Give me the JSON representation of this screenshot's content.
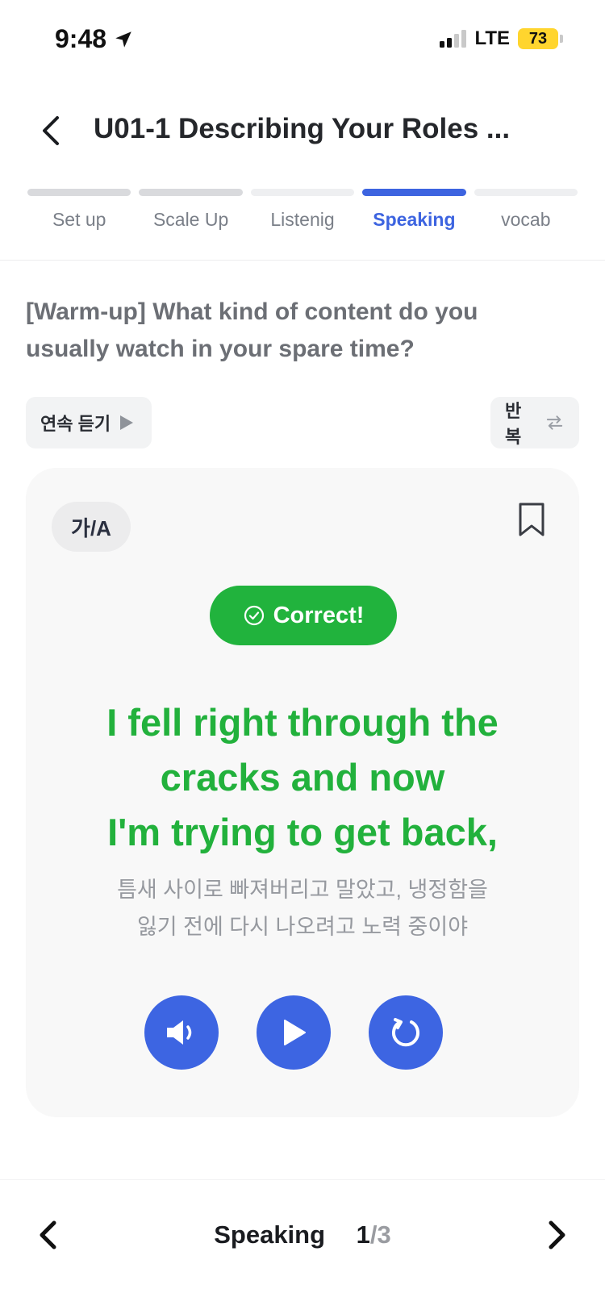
{
  "status_bar": {
    "time": "9:48",
    "network": "LTE",
    "battery": "73"
  },
  "header": {
    "title": "U01-1 Describing Your Roles ..."
  },
  "tabs": [
    {
      "label": "Set up",
      "state": "done"
    },
    {
      "label": "Scale Up",
      "state": "done"
    },
    {
      "label": "Listenig",
      "state": "todo"
    },
    {
      "label": "Speaking",
      "state": "active"
    },
    {
      "label": "vocab",
      "state": "todo"
    }
  ],
  "question": "[Warm-up] What kind of content do you usually watch in your spare time?",
  "controls": {
    "continuous_listen_label": "연속 듣기",
    "repeat_label": "반복"
  },
  "card": {
    "lang_toggle": "가/A",
    "badge": "Correct!",
    "sentence_lines": [
      "I fell right through the",
      "cracks and now",
      "I'm trying to get back,"
    ],
    "translation_lines": [
      "틈새 사이로 빠져버리고 말았고, 냉정함을",
      "잃기 전에 다시 나오려고 노력 중이야"
    ]
  },
  "bottom_nav": {
    "section": "Speaking",
    "current_page": "1",
    "total_pages": "/3"
  },
  "colors": {
    "accent": "#3d64e0",
    "success": "#21b33d",
    "battery": "#ffd52e"
  }
}
